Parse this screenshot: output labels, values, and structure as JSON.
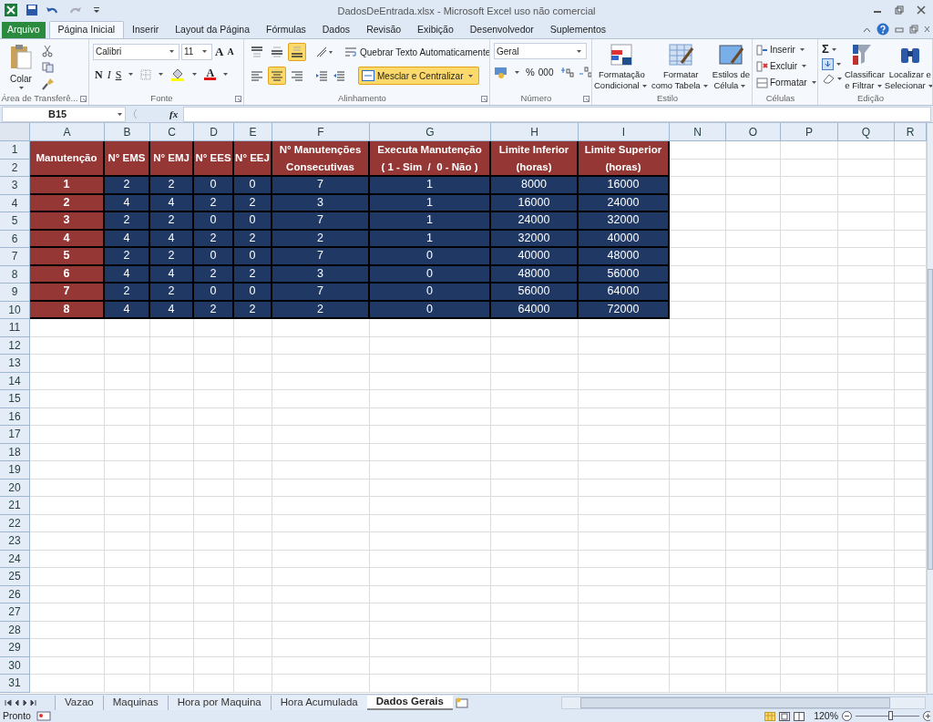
{
  "title_bar": {
    "title": "DadosDeEntrada.xlsx - Microsoft Excel uso não comercial"
  },
  "menu_tabs": [
    {
      "label": "Arquivo",
      "kind": "file",
      "selected": false
    },
    {
      "label": "Página Inicial",
      "kind": "tab",
      "selected": true
    },
    {
      "label": "Inserir",
      "kind": "tab",
      "selected": false
    },
    {
      "label": "Layout da Página",
      "kind": "tab",
      "selected": false
    },
    {
      "label": "Fórmulas",
      "kind": "tab",
      "selected": false
    },
    {
      "label": "Dados",
      "kind": "tab",
      "selected": false
    },
    {
      "label": "Revisão",
      "kind": "tab",
      "selected": false
    },
    {
      "label": "Exibição",
      "kind": "tab",
      "selected": false
    },
    {
      "label": "Desenvolvedor",
      "kind": "tab",
      "selected": false
    },
    {
      "label": "Suplementos",
      "kind": "tab",
      "selected": false
    }
  ],
  "ribbon": {
    "clipboard": {
      "label": "Área de Transferê...",
      "paste": "Colar"
    },
    "font": {
      "label": "Fonte",
      "font_name": "Calibri",
      "font_size": "11",
      "grow_font": "A",
      "shrink_font": "A",
      "bold": "N",
      "italic": "I",
      "underline": "S",
      "font_color": "A"
    },
    "alignment": {
      "label": "Alinhamento",
      "vertical_align": [
        {
          "selected": false
        },
        {
          "selected": false
        },
        {
          "selected": true
        }
      ],
      "horizontal_align": [
        {
          "selected": false
        },
        {
          "selected": true
        },
        {
          "selected": false
        }
      ],
      "wrap_text": "Quebrar Texto Automaticamente",
      "merge": {
        "label": "Mesclar e Centralizar",
        "selected": true
      }
    },
    "number": {
      "label": "Número",
      "format": "Geral",
      "percent": "%",
      "thousands": "000"
    },
    "styles": {
      "label": "Estilo",
      "buttons": [
        {
          "lines": [
            "Formatação",
            "Condicional"
          ]
        },
        {
          "lines": [
            "Formatar",
            "como Tabela"
          ]
        },
        {
          "lines": [
            "Estilos de",
            "Célula"
          ]
        }
      ]
    },
    "cells": {
      "label": "Células",
      "buttons": [
        "Inserir",
        "Excluir",
        "Formatar"
      ]
    },
    "editing": {
      "label": "Edição",
      "autosum": "Σ",
      "buttons": [
        {
          "lines": [
            "Classificar",
            "e Filtrar"
          ]
        },
        {
          "lines": [
            "Localizar e",
            "Selecionar"
          ]
        }
      ]
    }
  },
  "formula_bar": {
    "name_box": "B15",
    "function_label": "fx"
  },
  "column_headers": [
    "A",
    "B",
    "C",
    "D",
    "E",
    "F",
    "G",
    "H",
    "I",
    "N",
    "O",
    "P",
    "Q",
    "R"
  ],
  "row_headers": [
    "1",
    "2",
    "3",
    "4",
    "5",
    "6",
    "7",
    "8",
    "9",
    "10",
    "11",
    "12",
    "13",
    "14",
    "15",
    "16",
    "17",
    "18",
    "19",
    "20",
    "21",
    "22",
    "23",
    "24",
    "25",
    "26",
    "27",
    "28",
    "29",
    "30",
    "31"
  ],
  "table": {
    "header": [
      "Manutenção",
      "N° EMS",
      "N° EMJ",
      "N° EES",
      "N° EEJ",
      "N° Manutenções\nConsecutivas",
      "Executa Manutenção\n( 1 - Sim  /  0 - Não )",
      "Limite Inferior\n(horas)",
      "Limite Superior\n(horas)"
    ],
    "rows": [
      [
        "1",
        "2",
        "2",
        "0",
        "0",
        "7",
        "1",
        "8000",
        "16000"
      ],
      [
        "2",
        "4",
        "4",
        "2",
        "2",
        "3",
        "1",
        "16000",
        "24000"
      ],
      [
        "3",
        "2",
        "2",
        "0",
        "0",
        "7",
        "1",
        "24000",
        "32000"
      ],
      [
        "4",
        "4",
        "4",
        "2",
        "2",
        "2",
        "1",
        "32000",
        "40000"
      ],
      [
        "5",
        "2",
        "2",
        "0",
        "0",
        "7",
        "0",
        "40000",
        "48000"
      ],
      [
        "6",
        "4",
        "4",
        "2",
        "2",
        "3",
        "0",
        "48000",
        "56000"
      ],
      [
        "7",
        "2",
        "2",
        "0",
        "0",
        "7",
        "0",
        "56000",
        "64000"
      ],
      [
        "8",
        "4",
        "4",
        "2",
        "2",
        "2",
        "0",
        "64000",
        "72000"
      ]
    ]
  },
  "sheet_tabs": [
    {
      "label": "Vazao",
      "selected": false
    },
    {
      "label": "Maquinas",
      "selected": false
    },
    {
      "label": "Hora por Maquina",
      "selected": false
    },
    {
      "label": "Hora Acumulada",
      "selected": false
    },
    {
      "label": "Dados Gerais",
      "selected": true
    }
  ],
  "status_bar": {
    "status": "Pronto",
    "zoom": "120%",
    "zoom_slider": {
      "level": 0.55
    }
  }
}
